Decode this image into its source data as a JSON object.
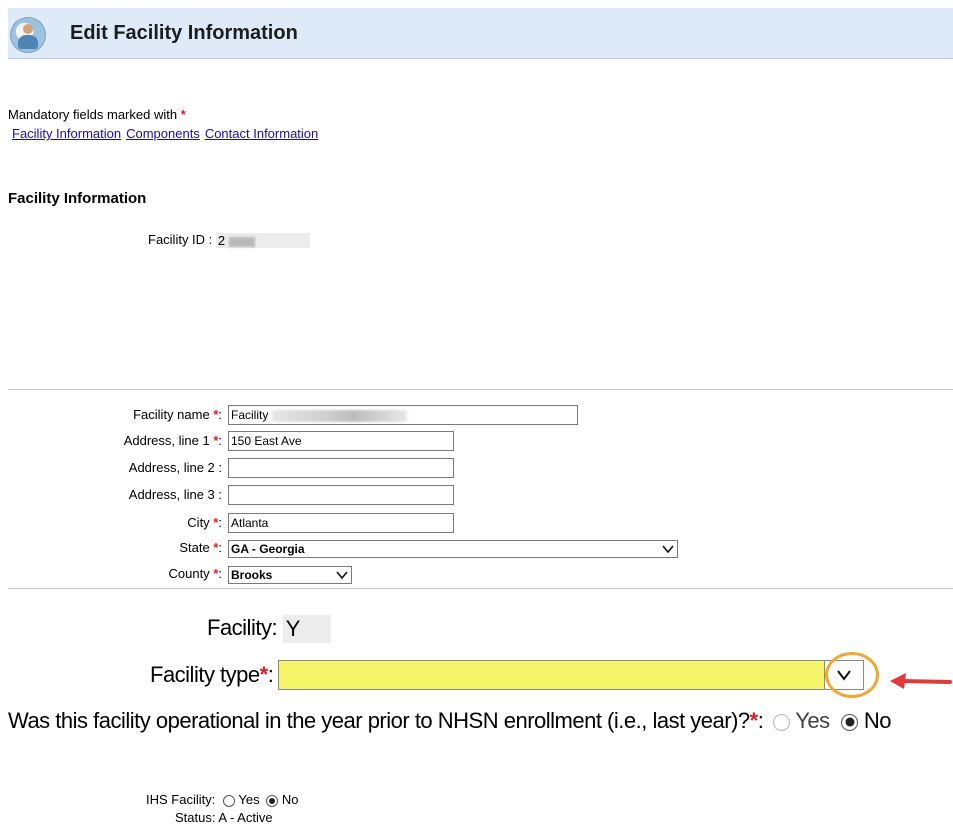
{
  "header": {
    "title": "Edit Facility Information",
    "icon": "user-globe-icon"
  },
  "mandatory": {
    "text": "Mandatory fields marked with",
    "star": "*"
  },
  "links": [
    {
      "label": "Facility Information"
    },
    {
      "label": "Components"
    },
    {
      "label": "Contact Information"
    }
  ],
  "section_title": "Facility Information",
  "facility_id": {
    "label": "Facility ID :",
    "value": "2"
  },
  "form": {
    "facility_name": {
      "label": "Facility name",
      "value": "Facility"
    },
    "address1": {
      "label": "Address, line 1",
      "value": "150 East Ave"
    },
    "address2": {
      "label": "Address, line 2 :",
      "value": ""
    },
    "address3": {
      "label": "Address, line 3 :",
      "value": ""
    },
    "city": {
      "label": "City",
      "value": "Atlanta"
    },
    "state": {
      "label": "State",
      "value": "GA - Georgia"
    },
    "county": {
      "label": "County",
      "value": "Brooks"
    },
    "colon": ":"
  },
  "facility_flag": {
    "label": "Facility:",
    "value": "Y"
  },
  "facility_type": {
    "label": "Facility type",
    "value": ""
  },
  "operational": {
    "question": "Was this facility operational in the year prior to NHSN enrollment (i.e., last year)?",
    "yes": "Yes",
    "no": "No",
    "selected": "No"
  },
  "ihs": {
    "label": "IHS Facility:",
    "yes": "Yes",
    "no": "No",
    "selected": "No"
  },
  "status": {
    "label": "Status:",
    "value": "A - Active"
  },
  "colors": {
    "accent_red": "#e31b23",
    "highlight_yellow": "#f7f569",
    "callout_orange": "#f0a830",
    "header_bg": "#deeaf8"
  }
}
